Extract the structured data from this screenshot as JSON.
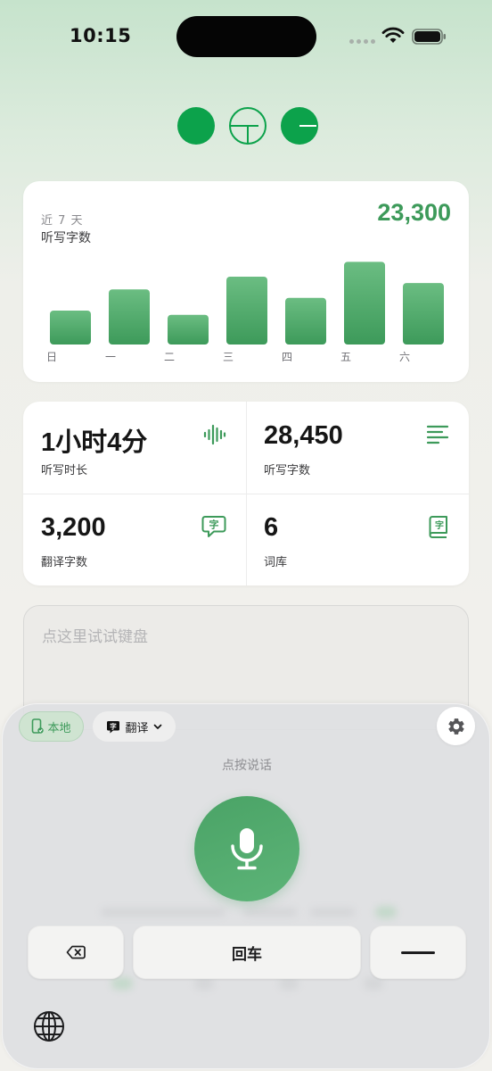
{
  "status_bar": {
    "time": "10:15"
  },
  "chart_card": {
    "period": "近 7 天",
    "title": "听写字数",
    "total": "23,300"
  },
  "chart_data": {
    "type": "bar",
    "categories": [
      "日",
      "一",
      "二",
      "三",
      "四",
      "五",
      "六"
    ],
    "values": [
      1600,
      2600,
      1400,
      3200,
      2200,
      3900,
      2900
    ],
    "ylim": [
      0,
      4000
    ],
    "title": "听写字数",
    "xlabel": "",
    "ylabel": "",
    "grid": false,
    "legend": "none",
    "bar_color": "#4aa366"
  },
  "stats": {
    "duration": {
      "value": "1小时4分",
      "label": "听写时长",
      "icon": "waveform-icon"
    },
    "dictation_chars": {
      "value": "28,450",
      "label": "听写字数",
      "icon": "text-lines-icon"
    },
    "translation_chars": {
      "value": "3,200",
      "label": "翻译字数",
      "icon": "translate-bubble-icon"
    },
    "vocabulary": {
      "value": "6",
      "label": "词库",
      "icon": "book-icon"
    }
  },
  "try_input": {
    "placeholder": "点这里试试键盘"
  },
  "keyboard": {
    "local_label": "本地",
    "translate_label": "翻译",
    "translate_badge": "字",
    "hint": "点按说话",
    "enter_label": "回车"
  },
  "colors": {
    "accent": "#3d9a5a",
    "accent_light": "#cfe4d1",
    "card": "#ffffff",
    "background_top": "#c6e3cc"
  }
}
